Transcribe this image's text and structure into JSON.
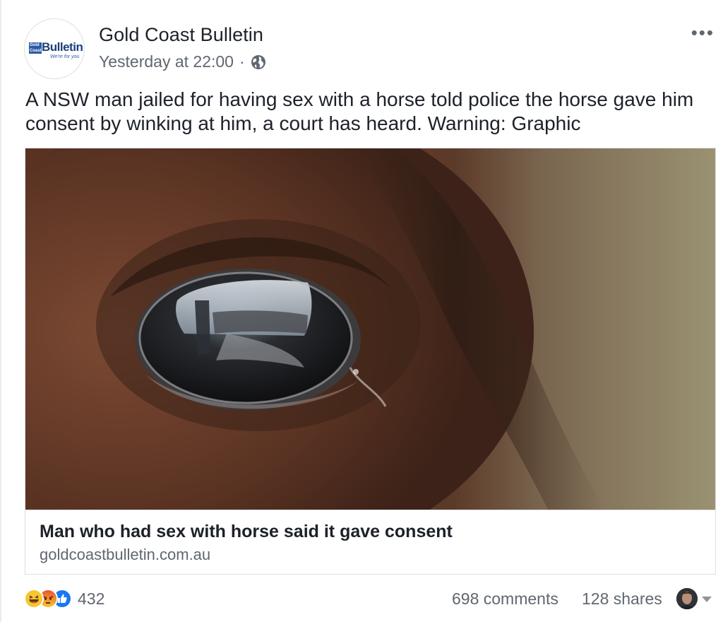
{
  "post": {
    "page_name": "Gold Coast Bulletin",
    "timestamp": "Yesterday at 22:00",
    "separator": "·",
    "privacy_icon": "globe-icon",
    "more_icon": "more-options-icon",
    "more_label": "•••",
    "text": "A NSW man jailed for having sex with a horse told police the horse gave him consent by winking at him, a court has heard. Warning: Graphic"
  },
  "avatar": {
    "logo_small": "Gold Coast",
    "logo_word": "Bulletin",
    "logo_tagline": "We're for you"
  },
  "link_card": {
    "image_icon": "horse-eye-photo",
    "title": "Man who had sex with horse said it gave consent",
    "domain": "goldcoastbulletin.com.au"
  },
  "footer": {
    "reaction_icons": [
      "haha-icon",
      "angry-icon",
      "like-icon"
    ],
    "reaction_count": "432",
    "comments": "698 comments",
    "shares": "128 shares",
    "viewer_icon": "viewer-avatar",
    "dropdown_icon": "caret-down-icon"
  },
  "colors": {
    "text": "#1d2129",
    "secondary": "#606770",
    "border": "#dddfe2",
    "like_blue": "#1877f2",
    "haha_yellow": "#f7c630",
    "angry_red": "#e9552f"
  }
}
